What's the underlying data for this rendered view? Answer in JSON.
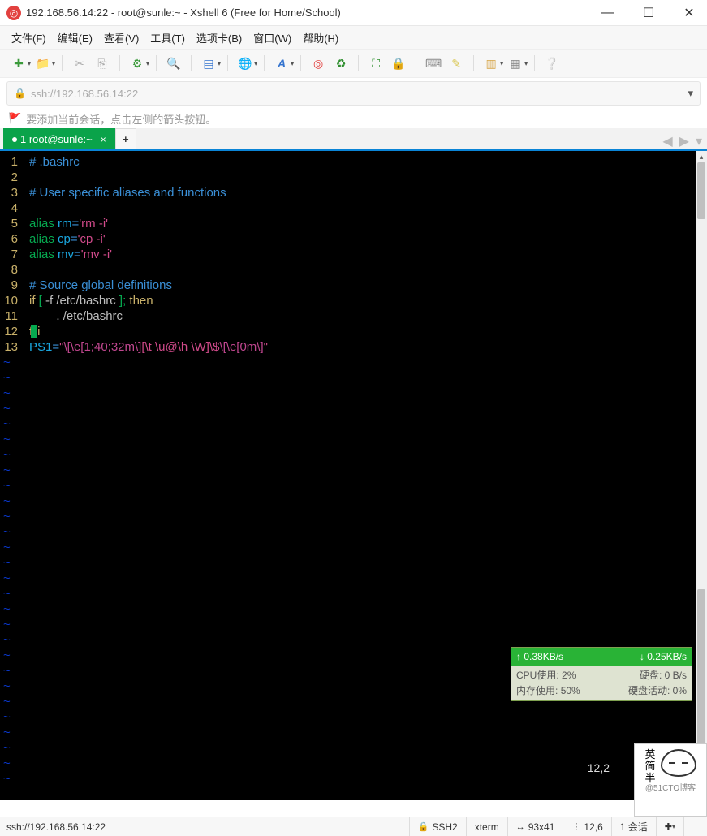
{
  "window": {
    "title": "192.168.56.14:22 - root@sunle:~ - Xshell 6 (Free for Home/School)"
  },
  "menu": {
    "file": "文件(F)",
    "edit": "编辑(E)",
    "view": "查看(V)",
    "tools": "工具(T)",
    "tabs": "选项卡(B)",
    "window": "窗口(W)",
    "help": "帮助(H)"
  },
  "address": {
    "url": "ssh://192.168.56.14:22"
  },
  "info_hint": "要添加当前会话，点击左侧的箭头按钮。",
  "tab": {
    "label": "1 root@sunle:~"
  },
  "editor": {
    "lines": [
      {
        "n": "1",
        "tokens": [
          [
            "c-comment",
            "# .bashrc"
          ]
        ]
      },
      {
        "n": "2",
        "tokens": [
          [
            "",
            ""
          ]
        ]
      },
      {
        "n": "3",
        "tokens": [
          [
            "c-comment",
            "# User specific aliases and functions"
          ]
        ]
      },
      {
        "n": "4",
        "tokens": [
          [
            "",
            ""
          ]
        ]
      },
      {
        "n": "5",
        "tokens": [
          [
            "c-cmd",
            "alias "
          ],
          [
            "c-var",
            "rm"
          ],
          [
            "c-eq",
            "="
          ],
          [
            "c-str",
            "'rm -i'"
          ]
        ]
      },
      {
        "n": "6",
        "tokens": [
          [
            "c-cmd",
            "alias "
          ],
          [
            "c-var",
            "cp"
          ],
          [
            "c-eq",
            "="
          ],
          [
            "c-str",
            "'cp -i'"
          ]
        ]
      },
      {
        "n": "7",
        "tokens": [
          [
            "c-cmd",
            "alias "
          ],
          [
            "c-var",
            "mv"
          ],
          [
            "c-eq",
            "="
          ],
          [
            "c-str",
            "'mv -i'"
          ]
        ]
      },
      {
        "n": "8",
        "tokens": [
          [
            "",
            ""
          ]
        ]
      },
      {
        "n": "9",
        "tokens": [
          [
            "c-comment",
            "# Source global definitions"
          ]
        ]
      },
      {
        "n": "10",
        "tokens": [
          [
            "c-kw",
            "if"
          ],
          [
            "c-punct",
            " [ "
          ],
          [
            "c-path",
            "-f "
          ],
          [
            "c-path",
            "/etc/bashrc"
          ],
          [
            "c-punct",
            " ]; "
          ],
          [
            "c-kw",
            "then"
          ]
        ]
      },
      {
        "n": "11",
        "tokens": [
          [
            "",
            "        . "
          ],
          [
            "c-path",
            "/etc/bashrc"
          ]
        ]
      },
      {
        "n": "12",
        "tokens": [
          [
            "c-kw",
            "f"
          ],
          [
            "cursor",
            ""
          ],
          [
            "c-kw",
            "i"
          ]
        ]
      },
      {
        "n": "13",
        "tokens": [
          [
            "c-var",
            "PS1"
          ],
          [
            "c-eq",
            "="
          ],
          [
            "c-str",
            "\""
          ],
          [
            "c-magenta",
            "\\[\\e[1;40;32m\\]"
          ],
          [
            "c-str",
            "[\\t \\u@\\h \\W]\\$"
          ],
          [
            "c-magenta",
            "\\[\\e[0m\\]"
          ],
          [
            "c-str",
            "\""
          ]
        ]
      }
    ],
    "cursor_pos": "12,2"
  },
  "netwidget": {
    "up": "↑ 0.38KB/s",
    "down": "↓ 0.25KB/s",
    "cpu_label": "CPU使用:",
    "cpu_val": "2%",
    "disk_label": "硬盘:",
    "disk_val": "0 B/s",
    "mem_label": "内存使用:",
    "mem_val": "50%",
    "act_label": "硬盘活动:",
    "act_val": "0%"
  },
  "status": {
    "addr": "ssh://192.168.56.14:22",
    "proto": "SSH2",
    "term": "xterm",
    "size": "93x41",
    "pos": "12,6",
    "sessions": "1 会话"
  },
  "avatar": {
    "line1": "英",
    "line2": "简",
    "line3": "半",
    "sub": "@51CTO博客"
  },
  "iconnames": {
    "new": "new-file-icon",
    "open": "folder-open-icon",
    "cut": "cut-icon",
    "copy": "copy-icon",
    "settings": "settings-icon",
    "search": "search-icon",
    "view": "layout-icon",
    "globe": "globe-icon",
    "font": "font-icon",
    "shell": "shell-icon",
    "recycle": "recycle-icon",
    "fit": "fit-icon",
    "lock": "lock2-icon",
    "keyboard": "keyboard-icon",
    "highlight": "highlight-icon",
    "pane": "pane-icon",
    "grid": "grid-icon",
    "help": "help-icon"
  }
}
